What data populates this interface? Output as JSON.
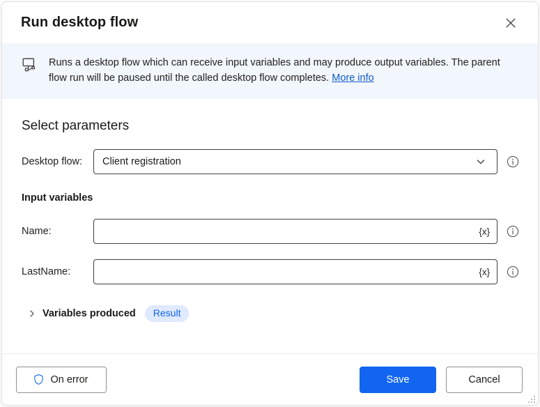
{
  "header": {
    "title": "Run desktop flow",
    "close_label": "Close"
  },
  "banner": {
    "icon": "desktop-flow-icon",
    "text": "Runs a desktop flow which can receive input variables and may produce output variables. The parent flow run will be paused until the called desktop flow completes.",
    "link_label": "More info"
  },
  "body": {
    "section_title": "Select parameters",
    "desktop_flow": {
      "label": "Desktop flow:",
      "value": "Client registration",
      "chevron_icon": "chevron-down-icon",
      "info_icon": "info-circle-icon"
    },
    "input_variables": {
      "title": "Input variables",
      "fields": [
        {
          "label": "Name:",
          "value": "",
          "placeholder": "",
          "variable_button": "{x}",
          "info_icon": "info-circle-icon"
        },
        {
          "label": "LastName:",
          "value": "",
          "placeholder": "",
          "variable_button": "{x}",
          "info_icon": "info-circle-icon"
        }
      ]
    },
    "variables_produced": {
      "expander_icon": "chevron-right-icon",
      "label": "Variables produced",
      "badge": "Result"
    }
  },
  "footer": {
    "on_error_label": "On error",
    "on_error_icon": "shield-icon",
    "save_label": "Save",
    "cancel_label": "Cancel"
  },
  "colors": {
    "accent_blue": "#1165f0",
    "link_blue": "#0f5bc8",
    "banner_bg": "#f2f6fd",
    "badge_bg": "#dfeaff",
    "badge_text": "#1463e8",
    "border_gray": "#919191"
  }
}
